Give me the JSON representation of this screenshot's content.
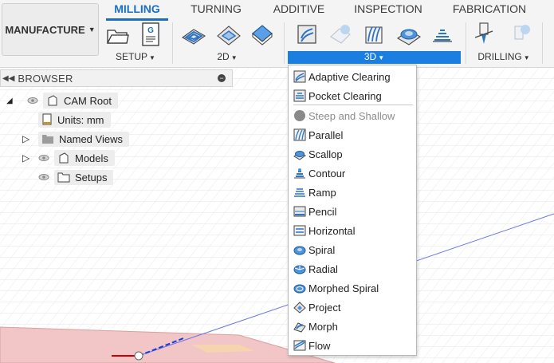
{
  "workspace": {
    "label": "MANUFACTURE"
  },
  "tabs": [
    {
      "label": "MILLING",
      "active": true
    },
    {
      "label": "TURNING",
      "active": false
    },
    {
      "label": "ADDITIVE",
      "active": false
    },
    {
      "label": "INSPECTION",
      "active": false
    },
    {
      "label": "FABRICATION",
      "active": false
    }
  ],
  "groups": {
    "setup": "SETUP",
    "twod": "2D",
    "threed": "3D",
    "drilling": "DRILLING"
  },
  "browser": {
    "title": "BROWSER",
    "items": [
      {
        "label": "CAM Root"
      },
      {
        "label": "Units: mm"
      },
      {
        "label": "Named Views"
      },
      {
        "label": "Models"
      },
      {
        "label": "Setups"
      }
    ]
  },
  "menu": {
    "items": [
      {
        "label": "Adaptive Clearing",
        "icon": "adaptive-clearing-icon"
      },
      {
        "label": "Pocket Clearing",
        "icon": "pocket-clearing-icon"
      },
      {
        "label": "Steep and Shallow",
        "icon": "steep-shallow-icon",
        "disabled": true
      },
      {
        "label": "Parallel",
        "icon": "parallel-icon"
      },
      {
        "label": "Scallop",
        "icon": "scallop-icon"
      },
      {
        "label": "Contour",
        "icon": "contour-icon"
      },
      {
        "label": "Ramp",
        "icon": "ramp-icon"
      },
      {
        "label": "Pencil",
        "icon": "pencil-icon"
      },
      {
        "label": "Horizontal",
        "icon": "horizontal-icon"
      },
      {
        "label": "Spiral",
        "icon": "spiral-icon"
      },
      {
        "label": "Radial",
        "icon": "radial-icon"
      },
      {
        "label": "Morphed Spiral",
        "icon": "morphed-spiral-icon"
      },
      {
        "label": "Project",
        "icon": "project-icon"
      },
      {
        "label": "Morph",
        "icon": "morph-icon"
      },
      {
        "label": "Flow",
        "icon": "flow-icon"
      }
    ]
  },
  "colors": {
    "accent": "#1a6fc4",
    "active_group": "#1a7fe0",
    "icon_blue": "#2f74c0"
  }
}
